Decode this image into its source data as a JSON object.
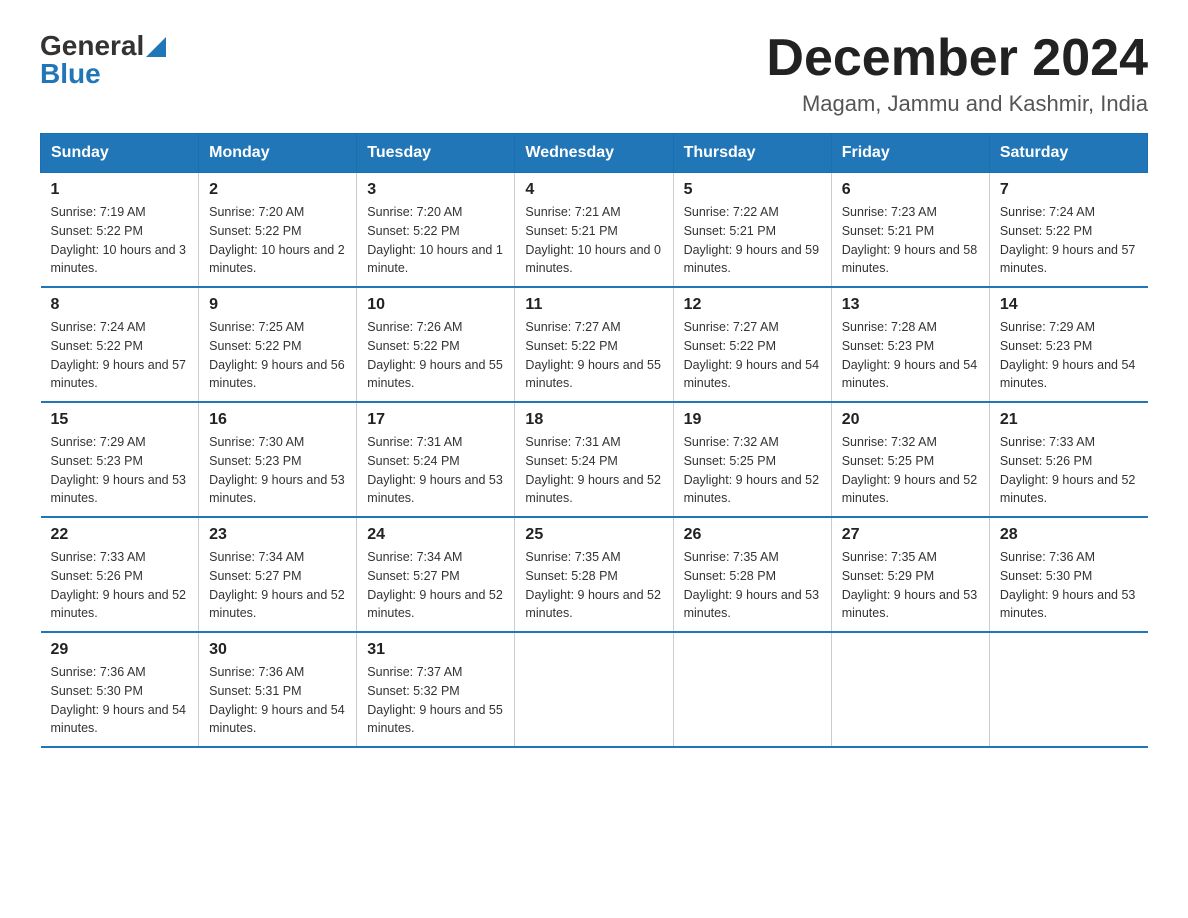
{
  "header": {
    "logo_general": "General",
    "logo_blue": "Blue",
    "month_title": "December 2024",
    "location": "Magam, Jammu and Kashmir, India"
  },
  "weekdays": [
    "Sunday",
    "Monday",
    "Tuesday",
    "Wednesday",
    "Thursday",
    "Friday",
    "Saturday"
  ],
  "weeks": [
    [
      {
        "day": "1",
        "sunrise": "7:19 AM",
        "sunset": "5:22 PM",
        "daylight": "10 hours and 3 minutes."
      },
      {
        "day": "2",
        "sunrise": "7:20 AM",
        "sunset": "5:22 PM",
        "daylight": "10 hours and 2 minutes."
      },
      {
        "day": "3",
        "sunrise": "7:20 AM",
        "sunset": "5:22 PM",
        "daylight": "10 hours and 1 minute."
      },
      {
        "day": "4",
        "sunrise": "7:21 AM",
        "sunset": "5:21 PM",
        "daylight": "10 hours and 0 minutes."
      },
      {
        "day": "5",
        "sunrise": "7:22 AM",
        "sunset": "5:21 PM",
        "daylight": "9 hours and 59 minutes."
      },
      {
        "day": "6",
        "sunrise": "7:23 AM",
        "sunset": "5:21 PM",
        "daylight": "9 hours and 58 minutes."
      },
      {
        "day": "7",
        "sunrise": "7:24 AM",
        "sunset": "5:22 PM",
        "daylight": "9 hours and 57 minutes."
      }
    ],
    [
      {
        "day": "8",
        "sunrise": "7:24 AM",
        "sunset": "5:22 PM",
        "daylight": "9 hours and 57 minutes."
      },
      {
        "day": "9",
        "sunrise": "7:25 AM",
        "sunset": "5:22 PM",
        "daylight": "9 hours and 56 minutes."
      },
      {
        "day": "10",
        "sunrise": "7:26 AM",
        "sunset": "5:22 PM",
        "daylight": "9 hours and 55 minutes."
      },
      {
        "day": "11",
        "sunrise": "7:27 AM",
        "sunset": "5:22 PM",
        "daylight": "9 hours and 55 minutes."
      },
      {
        "day": "12",
        "sunrise": "7:27 AM",
        "sunset": "5:22 PM",
        "daylight": "9 hours and 54 minutes."
      },
      {
        "day": "13",
        "sunrise": "7:28 AM",
        "sunset": "5:23 PM",
        "daylight": "9 hours and 54 minutes."
      },
      {
        "day": "14",
        "sunrise": "7:29 AM",
        "sunset": "5:23 PM",
        "daylight": "9 hours and 54 minutes."
      }
    ],
    [
      {
        "day": "15",
        "sunrise": "7:29 AM",
        "sunset": "5:23 PM",
        "daylight": "9 hours and 53 minutes."
      },
      {
        "day": "16",
        "sunrise": "7:30 AM",
        "sunset": "5:23 PM",
        "daylight": "9 hours and 53 minutes."
      },
      {
        "day": "17",
        "sunrise": "7:31 AM",
        "sunset": "5:24 PM",
        "daylight": "9 hours and 53 minutes."
      },
      {
        "day": "18",
        "sunrise": "7:31 AM",
        "sunset": "5:24 PM",
        "daylight": "9 hours and 52 minutes."
      },
      {
        "day": "19",
        "sunrise": "7:32 AM",
        "sunset": "5:25 PM",
        "daylight": "9 hours and 52 minutes."
      },
      {
        "day": "20",
        "sunrise": "7:32 AM",
        "sunset": "5:25 PM",
        "daylight": "9 hours and 52 minutes."
      },
      {
        "day": "21",
        "sunrise": "7:33 AM",
        "sunset": "5:26 PM",
        "daylight": "9 hours and 52 minutes."
      }
    ],
    [
      {
        "day": "22",
        "sunrise": "7:33 AM",
        "sunset": "5:26 PM",
        "daylight": "9 hours and 52 minutes."
      },
      {
        "day": "23",
        "sunrise": "7:34 AM",
        "sunset": "5:27 PM",
        "daylight": "9 hours and 52 minutes."
      },
      {
        "day": "24",
        "sunrise": "7:34 AM",
        "sunset": "5:27 PM",
        "daylight": "9 hours and 52 minutes."
      },
      {
        "day": "25",
        "sunrise": "7:35 AM",
        "sunset": "5:28 PM",
        "daylight": "9 hours and 52 minutes."
      },
      {
        "day": "26",
        "sunrise": "7:35 AM",
        "sunset": "5:28 PM",
        "daylight": "9 hours and 53 minutes."
      },
      {
        "day": "27",
        "sunrise": "7:35 AM",
        "sunset": "5:29 PM",
        "daylight": "9 hours and 53 minutes."
      },
      {
        "day": "28",
        "sunrise": "7:36 AM",
        "sunset": "5:30 PM",
        "daylight": "9 hours and 53 minutes."
      }
    ],
    [
      {
        "day": "29",
        "sunrise": "7:36 AM",
        "sunset": "5:30 PM",
        "daylight": "9 hours and 54 minutes."
      },
      {
        "day": "30",
        "sunrise": "7:36 AM",
        "sunset": "5:31 PM",
        "daylight": "9 hours and 54 minutes."
      },
      {
        "day": "31",
        "sunrise": "7:37 AM",
        "sunset": "5:32 PM",
        "daylight": "9 hours and 55 minutes."
      },
      null,
      null,
      null,
      null
    ]
  ],
  "labels": {
    "sunrise": "Sunrise:",
    "sunset": "Sunset:",
    "daylight": "Daylight:"
  }
}
